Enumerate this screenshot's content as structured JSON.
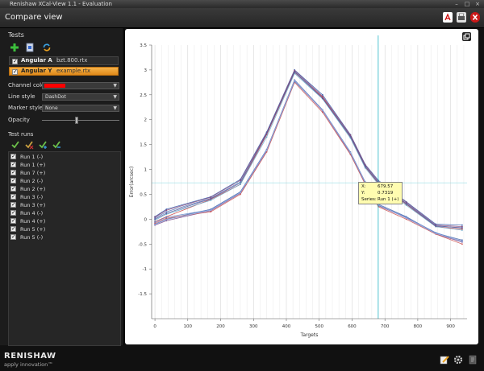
{
  "window": {
    "title": "Renishaw XCal-View 1.1 - Evaluation"
  },
  "header": {
    "title": "Compare view"
  },
  "tests": {
    "section_title": "Tests",
    "items": [
      {
        "name": "Angular A",
        "file": "bzt.800.rtx",
        "selected": false
      },
      {
        "name": "Angular Y",
        "file": "example.rtx",
        "selected": true
      }
    ]
  },
  "properties": {
    "channel_color_label": "Channel color",
    "channel_color": "#ff0000",
    "line_style_label": "Line style",
    "line_style_value": "DashDot",
    "marker_style_label": "Marker style",
    "marker_style_value": "None",
    "opacity_label": "Opacity",
    "opacity_value": 0.45
  },
  "test_runs": {
    "section_title": "Test runs",
    "items": [
      "Run 1 (-)",
      "Run 1 (+)",
      "Run 7 (+)",
      "Run 2 (-)",
      "Run 2 (+)",
      "Run 3 (-)",
      "Run 3 (+)",
      "Run 4 (-)",
      "Run 4 (+)",
      "Run 5 (+)",
      "Run 5 (-)"
    ]
  },
  "tooltip": {
    "x_label": "X:",
    "x_value": "679.57",
    "y_label": "Y:",
    "y_value": "0.7319",
    "series_label": "Series:",
    "series_value": "Run 1 (+)"
  },
  "footer": {
    "logo": "RENISHAW",
    "tagline": "apply innovation™"
  },
  "chart_data": {
    "type": "line",
    "xlabel": "Targets",
    "ylabel": "Error(arcsec)",
    "xlim": [
      -10,
      950
    ],
    "ylim": [
      -2.0,
      3.5
    ],
    "x_ticks": [
      0,
      100,
      200,
      300,
      400,
      500,
      600,
      700,
      800,
      900
    ],
    "y_ticks": [
      -1.5,
      -1,
      -0.5,
      0,
      0.5,
      1,
      1.5,
      2,
      2.5,
      3,
      3.5
    ],
    "x_tick_labels": [
      "0",
      "100",
      "200",
      "300",
      "400",
      "500",
      "600",
      "700",
      "800",
      "900"
    ],
    "y_tick_labels": [
      "-1.5",
      "-1",
      "-0.5",
      "0",
      "0.5",
      "1",
      "1.5",
      "2",
      "2.5",
      "3",
      "3.5"
    ],
    "grid": true,
    "crosshair": {
      "x": 679.57,
      "y": 0.7319
    },
    "x": [
      0,
      35,
      170,
      260,
      340,
      425,
      510,
      595,
      640,
      680,
      765,
      855,
      935
    ],
    "series": [
      {
        "color": "#3a5fae",
        "values": [
          0.05,
          0.2,
          0.45,
          0.8,
          1.75,
          3.0,
          2.5,
          1.7,
          1.1,
          0.78,
          0.35,
          -0.1,
          -0.12
        ]
      },
      {
        "color": "#5577bb",
        "values": [
          0.02,
          0.15,
          0.42,
          0.75,
          1.7,
          2.97,
          2.45,
          1.67,
          1.07,
          0.74,
          0.32,
          -0.13,
          -0.18
        ]
      },
      {
        "color": "#8a4a7a",
        "values": [
          0.04,
          0.18,
          0.44,
          0.78,
          1.73,
          2.99,
          2.47,
          1.69,
          1.09,
          0.76,
          0.34,
          -0.12,
          -0.15
        ]
      },
      {
        "color": "#cc4444",
        "values": [
          -0.05,
          0.05,
          0.4,
          0.7,
          1.7,
          2.95,
          2.45,
          1.65,
          1.05,
          0.72,
          0.3,
          -0.15,
          -0.2
        ]
      },
      {
        "color": "#66aacc",
        "values": [
          -0.02,
          0.1,
          0.38,
          0.7,
          1.65,
          2.93,
          2.42,
          1.63,
          1.03,
          0.7,
          0.28,
          -0.15,
          -0.22
        ]
      },
      {
        "color": "#4466aa",
        "values": [
          -0.1,
          0.0,
          0.2,
          0.55,
          1.4,
          2.8,
          2.2,
          1.35,
          0.75,
          0.3,
          0.05,
          -0.28,
          -0.42
        ]
      },
      {
        "color": "#7a4a8a",
        "values": [
          -0.12,
          -0.03,
          0.17,
          0.52,
          1.37,
          2.78,
          2.18,
          1.32,
          0.72,
          0.27,
          0.03,
          -0.3,
          -0.46
        ]
      },
      {
        "color": "#cc5555",
        "values": [
          -0.08,
          0.02,
          0.15,
          0.5,
          1.35,
          2.75,
          2.15,
          1.3,
          0.7,
          0.25,
          0.0,
          -0.3,
          -0.5
        ]
      },
      {
        "color": "#6688cc",
        "values": [
          -0.06,
          0.04,
          0.19,
          0.54,
          1.39,
          2.77,
          2.2,
          1.33,
          0.73,
          0.28,
          0.04,
          -0.27,
          -0.45
        ]
      },
      {
        "color": "#5a5a9a",
        "values": [
          0.0,
          0.12,
          0.41,
          0.73,
          1.72,
          2.96,
          2.43,
          1.66,
          1.06,
          0.73,
          0.31,
          -0.14,
          -0.17
        ]
      },
      {
        "color": "#99aadd",
        "values": [
          -0.11,
          -0.01,
          0.18,
          0.53,
          1.38,
          2.79,
          2.19,
          1.34,
          0.74,
          0.29,
          0.02,
          -0.29,
          -0.44
        ]
      }
    ]
  }
}
